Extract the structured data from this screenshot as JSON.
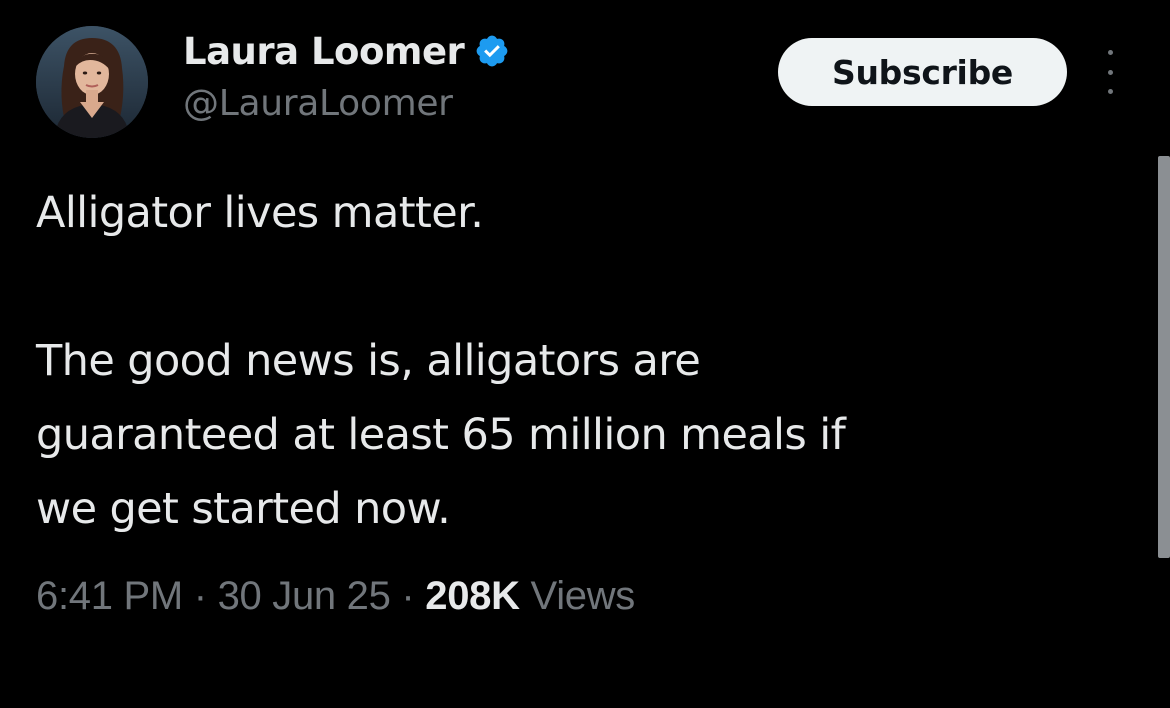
{
  "author": {
    "display_name": "Laura Loomer",
    "handle": "@LauraLoomer",
    "verified_icon": "verified-badge-icon",
    "avatar_icon": "profile-photo"
  },
  "actions": {
    "subscribe_label": "Subscribe",
    "more_icon": "vertical-ellipsis-icon"
  },
  "tweet": {
    "paragraphs": [
      "Alligator lives matter.",
      "The good news is, alligators are\nguaranteed at least 65 million meals if\nwe get started now."
    ]
  },
  "meta": {
    "time": "6:41 PM",
    "separator": "·",
    "date": "30 Jun 25",
    "views_count": "208K",
    "views_label": "Views"
  },
  "colors": {
    "background": "#000000",
    "primary_text": "#e7e9ea",
    "secondary_text": "#71767b",
    "verified_blue": "#1d9bf0",
    "button_bg": "#eff3f4"
  }
}
